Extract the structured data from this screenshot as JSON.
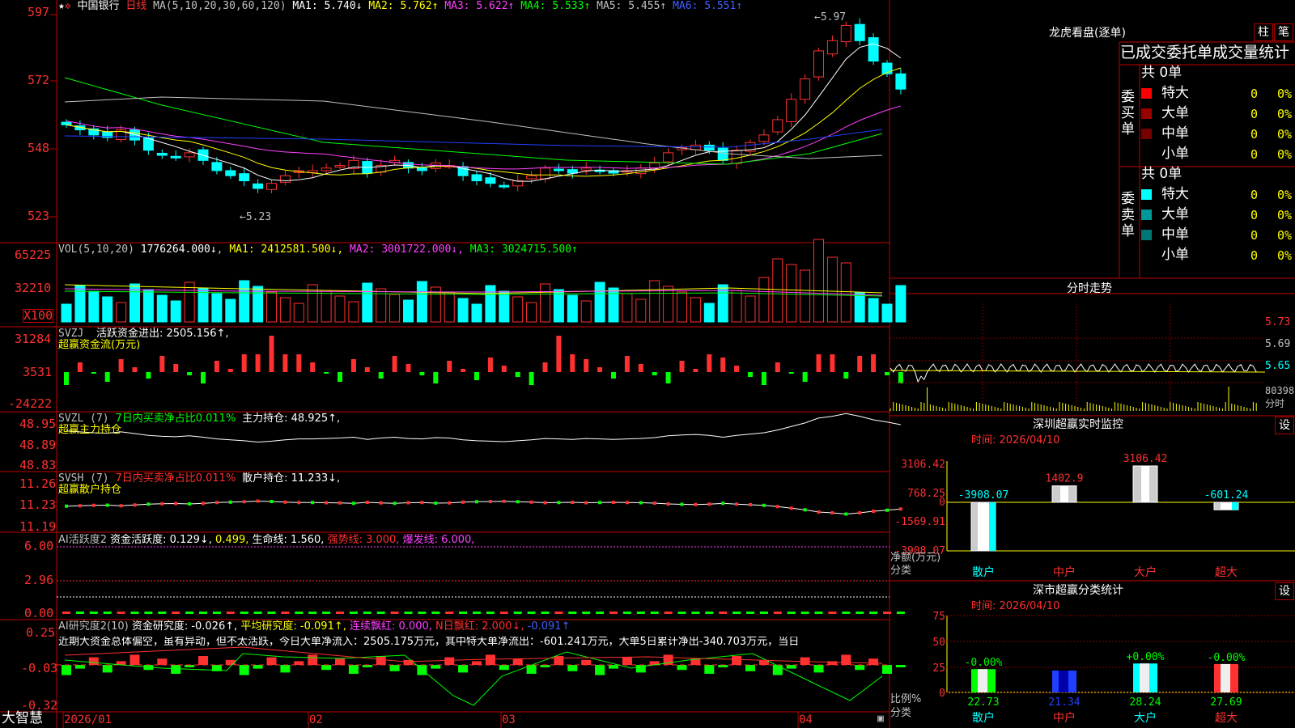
{
  "colors": {
    "up": "#ff3030",
    "down": "#00ffff",
    "border": "#c00000",
    "ma1": "#ffffff",
    "ma2": "#ffff00",
    "ma3": "#ff40ff",
    "ma4": "#00ff00",
    "ma5": "#c0c0c0",
    "ma6": "#2040ff"
  },
  "main": {
    "name": "中国银行",
    "period": "日线",
    "ma_label": "MA(5,10,20,30,60,120)",
    "ma": [
      {
        "k": "MA1",
        "v": "5.740↓"
      },
      {
        "k": "MA2",
        "v": "5.762↑"
      },
      {
        "k": "MA3",
        "v": "5.622↑"
      },
      {
        "k": "MA4",
        "v": "5.533↑"
      },
      {
        "k": "MA5",
        "v": "5.455↑"
      },
      {
        "k": "MA6",
        "v": "5.551↑"
      }
    ],
    "y_ticks": [
      "597",
      "572",
      "548",
      "523"
    ],
    "high_mark": "←5.97",
    "low_mark": "←5.23"
  },
  "vol": {
    "label": "VOL(5,10,20)",
    "value": "1776264.000↓",
    "ma": [
      {
        "k": "MA1",
        "v": "2412581.500↓"
      },
      {
        "k": "MA2",
        "v": "3001722.000↓"
      },
      {
        "k": "MA3",
        "v": "3024715.500↑"
      }
    ],
    "y_ticks": [
      "65225",
      "32210"
    ],
    "unit": "X100"
  },
  "svzj": {
    "label": "SVZJ",
    "text": "活跃资金进出: 2505.156↑,",
    "sub": "超赢资金流(万元)",
    "y_ticks": [
      "31284",
      "3531",
      "-24222"
    ]
  },
  "svzl": {
    "label": "SVZL (7)",
    "text1": "7日内买卖净占比0.011%",
    "text2": "主力持仓: 48.925↑,",
    "sub": "超赢主力持仓",
    "y_ticks": [
      "48.95",
      "48.89",
      "48.83"
    ]
  },
  "svsh": {
    "label": "SVSH (7)",
    "text1": "7日内买卖净占比0.011%",
    "text2": "散户持仓: 11.233↓,",
    "sub": "超赢散户持仓",
    "y_ticks": [
      "11.26",
      "11.23",
      "11.19"
    ]
  },
  "ai1": {
    "label": "AI活跃度2",
    "t1": "资金活跃度: 0.129↓,",
    "t2": "0.499,",
    "t3": "生命线: 1.560,",
    "t4": "强势线: 3.000,",
    "t5": "爆发线: 6.000,",
    "y_ticks": [
      "6.00",
      "2.96",
      "0.00"
    ]
  },
  "ai2": {
    "label": "AI研究度2(10)",
    "t1": "资金研究度: -0.026↑,",
    "t2": "平均研究度: -0.091↑,",
    "t3": "连续飘红: 0.000,",
    "t4": "N日飘红: 2.000↓,",
    "t5": "-0.091↑",
    "comment": "近期大资金总体偏空，虽有异动，但不太活跃，今日大单净流入：2505.175万元，其中特大单净流出：-601.241万元，大单5日累计净出-340.703万元，当日",
    "y_ticks": [
      "0.25",
      "-0.03",
      "-0.32"
    ]
  },
  "bottom": {
    "brand": "大智慧",
    "dates": [
      "2026/01",
      "02",
      "03",
      "04"
    ]
  },
  "right": {
    "lhb_title": "龙虎看盘(逐单)",
    "btn_zhu": "柱",
    "btn_bi": "笔",
    "stats_title": "已成交委托单成交量统计",
    "buy": {
      "label": "委买单",
      "total": "共 0单",
      "rows": [
        {
          "n": "特大",
          "v": "0",
          "p": "0%"
        },
        {
          "n": "大单",
          "v": "0",
          "p": "0%"
        },
        {
          "n": "中单",
          "v": "0",
          "p": "0%"
        },
        {
          "n": "小单",
          "v": "0",
          "p": "0%"
        }
      ]
    },
    "sell": {
      "label": "委卖单",
      "total": "共 0单",
      "rows": [
        {
          "n": "特大",
          "v": "0",
          "p": "0%"
        },
        {
          "n": "大单",
          "v": "0",
          "p": "0%"
        },
        {
          "n": "中单",
          "v": "0",
          "p": "0%"
        },
        {
          "n": "小单",
          "v": "0",
          "p": "0%"
        }
      ]
    },
    "fs_title": "分时走势",
    "fs_ticks": [
      "5.73",
      "5.69",
      "5.65"
    ],
    "fs_vol": "80398",
    "fs_vol_unit": "分时",
    "mon_title": "深圳超赢实时监控",
    "mon_btn": "设",
    "mon_time": "时间: 2026/04/10",
    "mon_ticks": [
      "3106.42",
      "768.25",
      "0",
      "-1569.91",
      "-3908.07"
    ],
    "mon_bars": [
      {
        "cat": "散户",
        "val": -3908.07,
        "label": "-3908.07"
      },
      {
        "cat": "中户",
        "val": 1402.9,
        "label": "1402.9"
      },
      {
        "cat": "大户",
        "val": 3106.42,
        "label": "3106.42"
      },
      {
        "cat": "超大",
        "val": -601.24,
        "label": "-601.24"
      }
    ],
    "mon_ylabel": "净额(万元)",
    "mon_xlabel": "分类",
    "cls_title": "深市超赢分类统计",
    "cls_btn": "设",
    "cls_time": "时间: 2026/04/10",
    "cls_ticks": [
      "75",
      "50",
      "25",
      "0"
    ],
    "cls_bars": [
      {
        "cat": "散户",
        "val": 22.73,
        "pct": "-0.00%"
      },
      {
        "cat": "中户",
        "val": 21.34,
        "pct": ""
      },
      {
        "cat": "大户",
        "val": 28.24,
        "pct": "+0.00%"
      },
      {
        "cat": "超大",
        "val": 27.69,
        "pct": "-0.00%"
      }
    ],
    "cls_ylabel": "比例%",
    "cls_xlabel": "分类"
  },
  "chart_data": {
    "type": "candlestick",
    "title": "中国银行 日线",
    "ylim": [
      5.2,
      6.0
    ],
    "close": [
      5.55,
      5.53,
      5.51,
      5.5,
      5.53,
      5.49,
      5.45,
      5.43,
      5.42,
      5.44,
      5.41,
      5.37,
      5.35,
      5.33,
      5.3,
      5.32,
      5.35,
      5.37,
      5.37,
      5.38,
      5.39,
      5.41,
      5.36,
      5.39,
      5.41,
      5.38,
      5.37,
      5.4,
      5.39,
      5.35,
      5.33,
      5.32,
      5.31,
      5.33,
      5.35,
      5.38,
      5.37,
      5.36,
      5.38,
      5.37,
      5.36,
      5.37,
      5.38,
      5.4,
      5.44,
      5.46,
      5.47,
      5.45,
      5.41,
      5.45,
      5.48,
      5.51,
      5.57,
      5.65,
      5.73,
      5.84,
      5.88,
      5.94,
      5.88,
      5.8,
      5.75,
      5.69
    ]
  }
}
